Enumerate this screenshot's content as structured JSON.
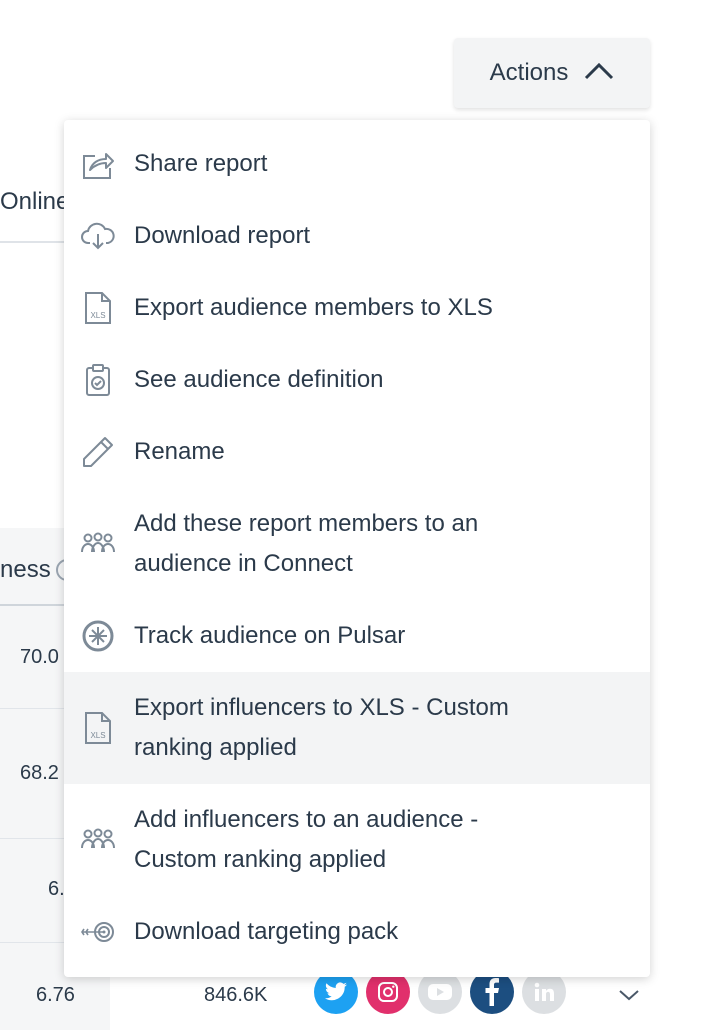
{
  "actions_button": {
    "label": "Actions",
    "icon": "chevron-up-icon"
  },
  "background": {
    "tab_label": "Online",
    "column_header": "ness",
    "table_values": [
      "70.0",
      "68.2",
      "6.",
      "6.76"
    ],
    "followers": "846.6K",
    "social_icons": [
      "twitter-icon",
      "instagram-icon",
      "youtube-icon",
      "facebook-icon",
      "linkedin-icon"
    ]
  },
  "menu": {
    "items": [
      {
        "label": "Share report",
        "icon": "share-icon"
      },
      {
        "label": "Download report",
        "icon": "cloud-download-icon"
      },
      {
        "label": "Export audience members to XLS",
        "icon": "xls-file-icon"
      },
      {
        "label": "See audience definition",
        "icon": "clipboard-check-icon"
      },
      {
        "label": "Rename",
        "icon": "pencil-icon"
      },
      {
        "label": "Add these report members to an\naudience in Connect",
        "icon": "people-group-icon"
      },
      {
        "label": "Track audience on Pulsar",
        "icon": "pulsar-icon"
      },
      {
        "label": "Export influencers to XLS - Custom\nranking applied",
        "icon": "xls-file-icon"
      },
      {
        "label": "Add influencers to an audience -\nCustom ranking applied",
        "icon": "people-group-icon"
      },
      {
        "label": "Download targeting pack",
        "icon": "target-icon"
      }
    ]
  },
  "colors": {
    "text": "#2b3a4a",
    "icon": "#7d8a97",
    "highlight": "#f3f4f5",
    "twitter": "#1da1f2",
    "instagram": "#e1306c",
    "facebook": "#1c4e80",
    "disabled": "#dcdfe2"
  }
}
